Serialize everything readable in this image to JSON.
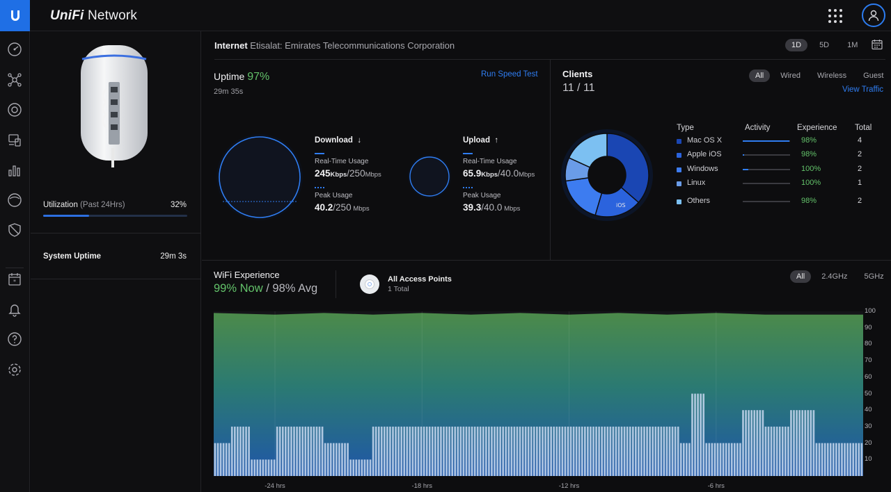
{
  "app": {
    "brand": "UniFi",
    "product": "Network"
  },
  "device_panel": {
    "utilization_label": "Utilization",
    "utilization_period": "(Past 24Hrs)",
    "utilization_value": "32%",
    "utilization_fraction": 0.32,
    "system_uptime_label": "System Uptime",
    "system_uptime_value": "29m 3s"
  },
  "internet": {
    "label": "Internet",
    "isp": "Etisalat: Emirates Telecommunications Corporation",
    "range_options": [
      "1D",
      "5D",
      "1M"
    ],
    "range_selected": "1D",
    "uptime_label": "Uptime",
    "uptime_pct": "97%",
    "uptime_duration": "29m 35s",
    "speed_test_label": "Run Speed Test",
    "download": {
      "title": "Download",
      "arrow": "↓",
      "realtime_label": "Real-Time Usage",
      "realtime_value": "245",
      "realtime_unit": "Kbps",
      "realtime_max": "250",
      "realtime_max_unit": "Mbps",
      "peak_label": "Peak Usage",
      "peak_value": "40.2",
      "peak_max": "250",
      "peak_unit": "Mbps"
    },
    "upload": {
      "title": "Upload",
      "arrow": "↑",
      "realtime_label": "Real-Time Usage",
      "realtime_value": "65.9",
      "realtime_unit": "Kbps",
      "realtime_max": "40.0",
      "realtime_max_unit": "Mbps",
      "peak_label": "Peak Usage",
      "peak_value": "39.3",
      "peak_max": "40.0",
      "peak_unit": "Mbps"
    }
  },
  "clients": {
    "title": "Clients",
    "count": "11 / 11",
    "filters": [
      "All",
      "Wired",
      "Wireless",
      "Guest"
    ],
    "filter_selected": "All",
    "view_traffic": "View Traffic",
    "headers": {
      "type": "Type",
      "activity": "Activity",
      "experience": "Experience",
      "total": "Total"
    },
    "rows": [
      {
        "name": "Mac OS X",
        "experience": "98%",
        "total": "4",
        "activity": 0.98,
        "color": "#1a46b3"
      },
      {
        "name": "Apple iOS",
        "experience": "98%",
        "total": "2",
        "activity": 0.03,
        "color": "#2b63dd"
      },
      {
        "name": "Windows",
        "experience": "100%",
        "total": "2",
        "activity": 0.12,
        "color": "#3d7cf0"
      },
      {
        "name": "Linux",
        "experience": "100%",
        "total": "1",
        "activity": 0.0,
        "color": "#6a9ce8"
      },
      {
        "name": "Others",
        "experience": "98%",
        "total": "2",
        "activity": 0.0,
        "color": "#7cc0f2"
      }
    ],
    "donut_label_ios": "iOS"
  },
  "wifi": {
    "title": "WiFi Experience",
    "now": "99% Now",
    "separator": "/",
    "avg": "98% Avg",
    "ap_title": "All Access Points",
    "ap_sub": "1 Total",
    "bands": [
      "All",
      "2.4GHz",
      "5GHz"
    ],
    "band_selected": "All"
  },
  "chart_data": {
    "type": "area",
    "title": "",
    "ylim": [
      0,
      100
    ],
    "yticks": [
      10,
      20,
      30,
      40,
      50,
      60,
      70,
      80,
      90,
      100
    ],
    "xticks": [
      "-24 hrs",
      "-18 hrs",
      "-12 hrs",
      "-6 hrs"
    ],
    "x_range_hours": [
      -26.5,
      0
    ],
    "series": [
      {
        "name": "",
        "kind": "area",
        "x": [
          -26.5,
          -24,
          -22,
          -20,
          -18,
          -16,
          -14,
          -12,
          -10,
          -8,
          -6,
          -4,
          -2,
          0
        ],
        "values": [
          99,
          98,
          99,
          98,
          99,
          98,
          99,
          98,
          99,
          98,
          99,
          98,
          98,
          98
        ]
      },
      {
        "name": "",
        "kind": "bars",
        "x": [
          -26.5,
          -25.8,
          -25,
          -24,
          -23,
          -22,
          -21,
          -20,
          -19,
          -18,
          -17,
          -16,
          -15,
          -14,
          -13,
          -12,
          -11,
          -10,
          -9,
          -8,
          -7.5,
          -7,
          -6.5,
          -6,
          -5,
          -4,
          -3,
          -2,
          -1,
          0
        ],
        "values": [
          20,
          30,
          10,
          30,
          30,
          20,
          10,
          30,
          30,
          30,
          30,
          30,
          30,
          30,
          30,
          30,
          30,
          30,
          30,
          30,
          20,
          50,
          20,
          20,
          40,
          30,
          40,
          20,
          20,
          30
        ]
      }
    ]
  }
}
